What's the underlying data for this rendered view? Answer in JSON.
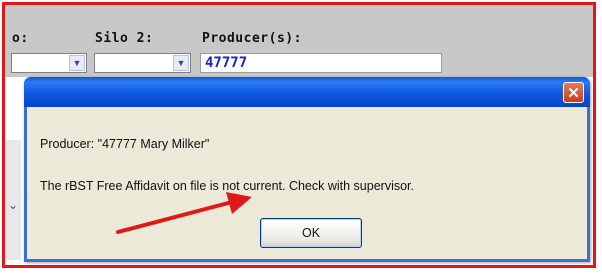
{
  "form": {
    "partial_label": "o:",
    "silo2_label": "Silo 2:",
    "producer_label": "Producer(s):",
    "producer_value": "47777"
  },
  "dialog": {
    "close_glyph": "✕",
    "producer_message": "Producer: \"47777  Mary Milker\"",
    "affidavit_message": "The rBST Free Affidavit on file is not current.  Check with supervisor.",
    "ok_label": "OK"
  },
  "colors": {
    "highlight_border": "#e01818",
    "title_bar": "#0a5ae6",
    "dialog_body": "#ece9d8",
    "producer_value_text": "#1a22cc",
    "arrow": "#e01818"
  }
}
